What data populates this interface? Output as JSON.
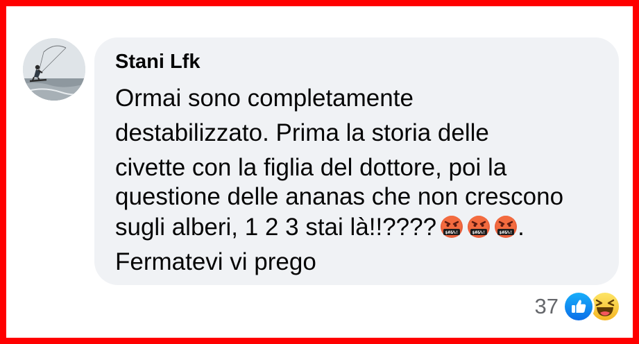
{
  "comment": {
    "author": "Stani Lfk",
    "text_lines": [
      "Ormai sono completamente",
      "destabilizzato. Prima la storia delle",
      "civette con la figlia del dottore, poi la",
      "questione delle ananas che non crescono",
      "sugli alberi, 1 2 3 stai là!!????",
      "Fermatevi vi prego"
    ],
    "emoji_after_line5": [
      "face-with-symbols-on-mouth-icon",
      "face-with-symbols-on-mouth-icon",
      "face-with-symbols-on-mouth-icon"
    ],
    "emoji_trailing_text": "."
  },
  "reactions": {
    "count": "37",
    "icons": [
      "like-icon",
      "haha-icon"
    ]
  },
  "colors": {
    "frame_border": "#ff0000",
    "bubble_bg": "#f0f2f5",
    "text": "#050505",
    "secondary_text": "#65676b",
    "like_blue": "#1877f2",
    "haha_yellow": "#f7b928"
  }
}
